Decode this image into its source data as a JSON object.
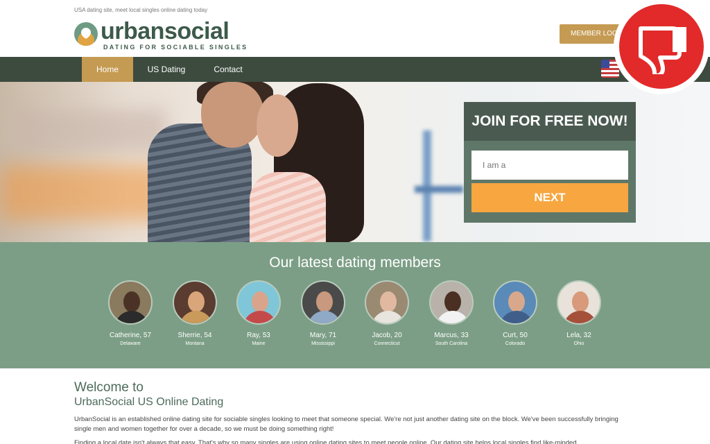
{
  "header": {
    "tagline": "USA dating site, meet local singles online dating today",
    "logo_word": "urbansocial",
    "logo_sub": "DATING FOR SOCIABLE SINGLES",
    "member_login": "MEMBER LOGIN"
  },
  "nav": {
    "items": [
      {
        "label": "Home",
        "active": true
      },
      {
        "label": "US Dating",
        "active": false
      },
      {
        "label": "Contact",
        "active": false
      }
    ]
  },
  "badge": {
    "icon": "thumbs-down-icon",
    "color": "#e22a2a"
  },
  "join": {
    "title": "JOIN FOR FREE NOW!",
    "select_placeholder": "I am a",
    "next_label": "NEXT"
  },
  "members": {
    "title": "Our latest dating members",
    "list": [
      {
        "name": "Catherine, 57",
        "location": "Delaware"
      },
      {
        "name": "Sherrie, 54",
        "location": "Montana"
      },
      {
        "name": "Ray, 53",
        "location": "Maine"
      },
      {
        "name": "Mary, 71",
        "location": "Mississippi"
      },
      {
        "name": "Jacob, 20",
        "location": "Connecticut"
      },
      {
        "name": "Marcus, 33",
        "location": "South Carolina"
      },
      {
        "name": "Curt, 50",
        "location": "Colorado"
      },
      {
        "name": "Lela, 32",
        "location": "Ohio"
      }
    ]
  },
  "welcome": {
    "heading1": "Welcome to",
    "heading2": "UrbanSocial US Online Dating",
    "para1": "UrbanSocial is an established online dating site for sociable singles looking to meet that someone special. We're not just another dating site on the block. We've been successfully bringing single men and women together for over a decade, so we must be doing something right!",
    "para2": "Finding a local date isn't always that easy. That's why so many singles are using online dating sites to meet people online. Our dating site helps local singles find like-minded"
  },
  "colors": {
    "nav_bg": "#3d4b3f",
    "accent_gold": "#c59a52",
    "members_bg": "#7c9e86",
    "next_button": "#f7a640"
  }
}
